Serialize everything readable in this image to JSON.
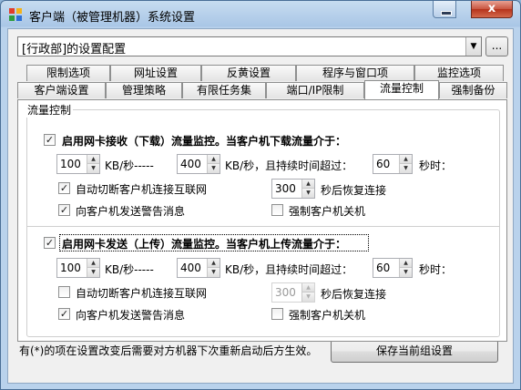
{
  "window": {
    "title": "客户端（被管理机器）系统设置",
    "close_glyph": "x",
    "icon_colors": [
      "#e23c2a",
      "#f3b21a",
      "#2f9d3e",
      "#2d6fd6"
    ]
  },
  "config_combo": {
    "value": "[行政部]的设置配置",
    "ellipsis_label": "..."
  },
  "tabs_row1": [
    "限制选项",
    "网址设置",
    "反黄设置",
    "程序与窗口项",
    "监控选项"
  ],
  "tabs_row2": [
    "客户端设置",
    "管理策略",
    "有限任务集",
    "端口/IP限制",
    "流量控制",
    "强制备份"
  ],
  "active_tab": "流量控制",
  "group_title": "流量控制",
  "download": {
    "enable_label": "启用网卡接收（下载）流量监控。当客户机下载流量介于：",
    "enabled": true,
    "min_value": "100",
    "unit_dash": "KB/秒-----",
    "max_value": "400",
    "duration_text": "KB/秒，且持续时间超过：",
    "duration_value": "60",
    "seconds_text": "秒时：",
    "auto_cut_label": "自动切断客户机连接互联网",
    "auto_cut": true,
    "restore_value": "300",
    "restore_text": "秒后恢复连接",
    "warn_label": "向客户机发送警告消息",
    "warn": true,
    "shutdown_label": "强制客户机关机",
    "shutdown": false
  },
  "upload": {
    "enable_label": "启用网卡发送（上传）流量监控。当客户机上传流量介于：",
    "enabled": true,
    "min_value": "100",
    "unit_dash": "KB/秒-----",
    "max_value": "400",
    "duration_text": "KB/秒，且持续时间超过：",
    "duration_value": "60",
    "seconds_text": "秒时：",
    "auto_cut_label": "自动切断客户机连接互联网",
    "auto_cut": false,
    "restore_value": "300",
    "restore_text": "秒后恢复连接",
    "warn_label": "向客户机发送警告消息",
    "warn": true,
    "shutdown_label": "强制客户机关机",
    "shutdown": false
  },
  "footer": {
    "note": "有(*)的项在设置改变后需要对方机器下次重新启动后方生效。",
    "save_label": "保存当前组设置"
  }
}
